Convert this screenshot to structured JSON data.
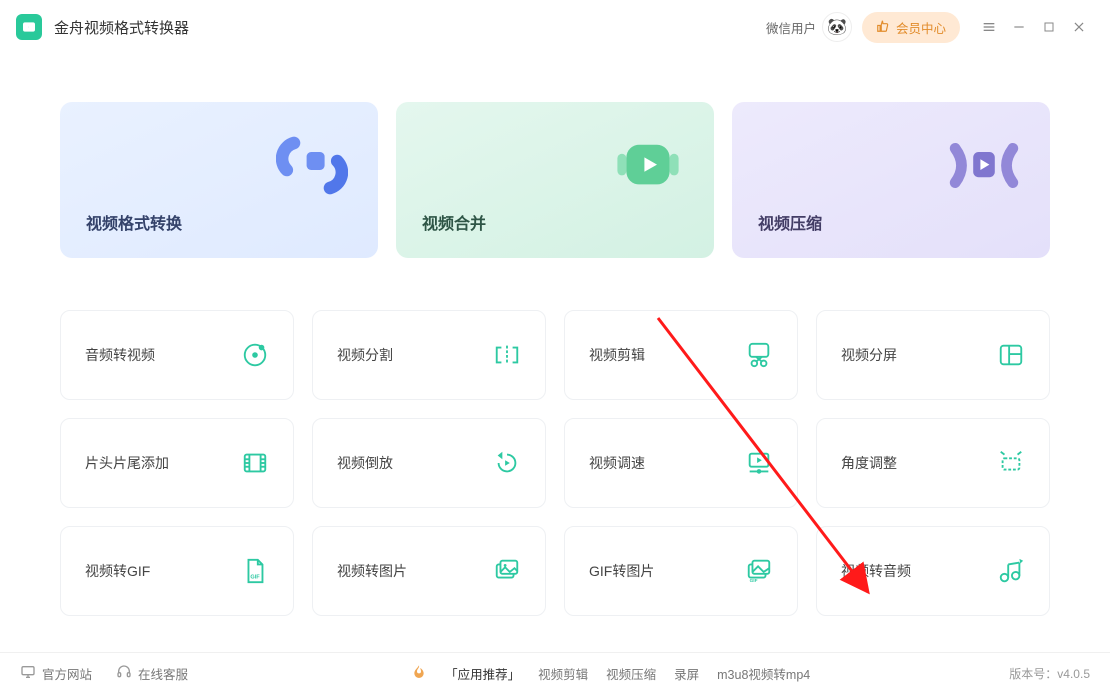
{
  "app": {
    "title": "金舟视频格式转换器"
  },
  "header": {
    "user_label": "微信用户",
    "member_button": "会员中心"
  },
  "features": [
    {
      "label": "视频格式转换"
    },
    {
      "label": "视频合并"
    },
    {
      "label": "视频压缩"
    }
  ],
  "tools": [
    {
      "label": "音频转视频",
      "icon": "disc"
    },
    {
      "label": "视频分割",
      "icon": "split"
    },
    {
      "label": "视频剪辑",
      "icon": "scissors"
    },
    {
      "label": "视频分屏",
      "icon": "grid2"
    },
    {
      "label": "片头片尾添加",
      "icon": "filmstrip"
    },
    {
      "label": "视频倒放",
      "icon": "rewind"
    },
    {
      "label": "视频调速",
      "icon": "speed"
    },
    {
      "label": "角度调整",
      "icon": "rotate"
    },
    {
      "label": "视频转GIF",
      "icon": "giffile"
    },
    {
      "label": "视频转图片",
      "icon": "images"
    },
    {
      "label": "GIF转图片",
      "icon": "gif2img"
    },
    {
      "label": "视频转音频",
      "icon": "music"
    }
  ],
  "footer": {
    "official_site": "官方网站",
    "online_support": "在线客服",
    "promo_title": "「应用推荐」",
    "promo_items": [
      "视频剪辑",
      "视频压缩",
      "录屏",
      "m3u8视频转mp4"
    ],
    "version_prefix": "版本号：",
    "version": "v4.0.5"
  },
  "annotation": {
    "target_tool_index": 11
  }
}
